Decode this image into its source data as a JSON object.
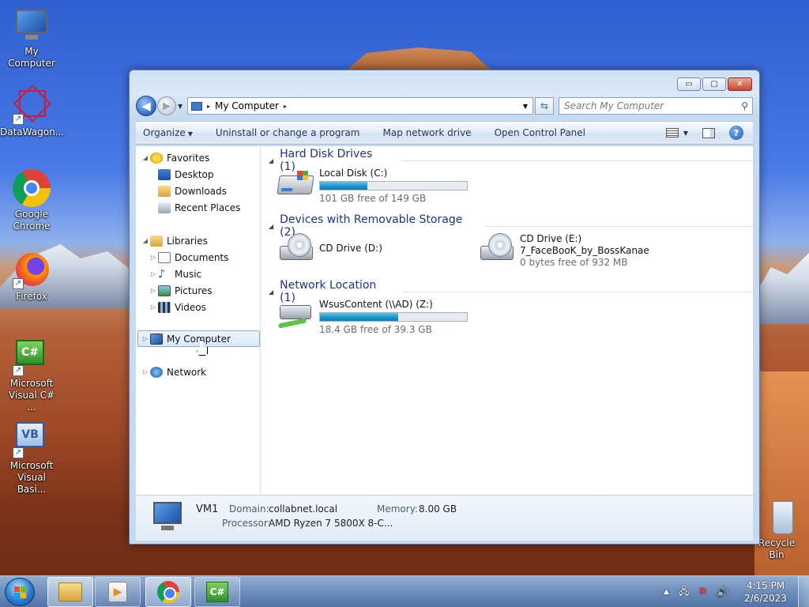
{
  "desktop": {
    "icons": [
      {
        "label": "My Computer",
        "icon": "computer-icon"
      },
      {
        "label": "DataWagon...",
        "icon": "datawagon-icon"
      },
      {
        "label": "Google Chrome",
        "icon": "chrome-icon"
      },
      {
        "label": "Firefox",
        "icon": "firefox-icon"
      },
      {
        "label": "Microsoft Visual C# ...",
        "icon": "csharp-icon"
      },
      {
        "label": "Microsoft Visual Basi...",
        "icon": "vb-icon"
      },
      {
        "label": "Recycle Bin",
        "icon": "recycle-bin-icon"
      }
    ]
  },
  "window": {
    "controls": {
      "minimize": "▭",
      "maximize": "▢",
      "close": "✕"
    },
    "address": {
      "crumb": "My Computer",
      "arrow": "▸"
    },
    "search": {
      "placeholder": "Search My Computer"
    },
    "toolbar": {
      "organize": "Organize",
      "uninstall": "Uninstall or change a program",
      "map_drive": "Map network drive",
      "control_panel": "Open Control Panel"
    },
    "nav": {
      "favorites": "Favorites",
      "desktop": "Desktop",
      "downloads": "Downloads",
      "recent": "Recent Places",
      "libraries": "Libraries",
      "documents": "Documents",
      "music": "Music",
      "pictures": "Pictures",
      "videos": "Videos",
      "my_computer": "My Computer",
      "network": "Network"
    },
    "groups": {
      "hard_disks": "Hard Disk Drives (1)",
      "removable": "Devices with Removable Storage (2)",
      "network": "Network Location (1)"
    },
    "drives": {
      "c": {
        "name": "Local Disk (C:)",
        "free": "101 GB free of 149 GB",
        "used_fraction": 0.32
      },
      "d": {
        "name": "CD Drive (D:)"
      },
      "e": {
        "name": "CD Drive (E:)",
        "label": "7_FaceBooK_by_BossKanae",
        "free": "0 bytes free of 932 MB"
      },
      "z": {
        "name": "WsusContent (\\\\AD) (Z:)",
        "free": "18.4 GB free of 39.3 GB",
        "used_fraction": 0.53
      }
    },
    "details": {
      "name": "VM1",
      "domain_label": "Domain:",
      "domain": "collabnet.local",
      "memory_label": "Memory:",
      "memory": "8.00 GB",
      "processor_label": "Processor:",
      "processor": "AMD Ryzen 7 5800X 8-C..."
    }
  },
  "taskbar": {
    "time": "4:15 PM",
    "date": "2/6/2023",
    "tray": {
      "up": "▲",
      "network": "🖧",
      "flag": "⚑",
      "volume": "🔊"
    }
  }
}
